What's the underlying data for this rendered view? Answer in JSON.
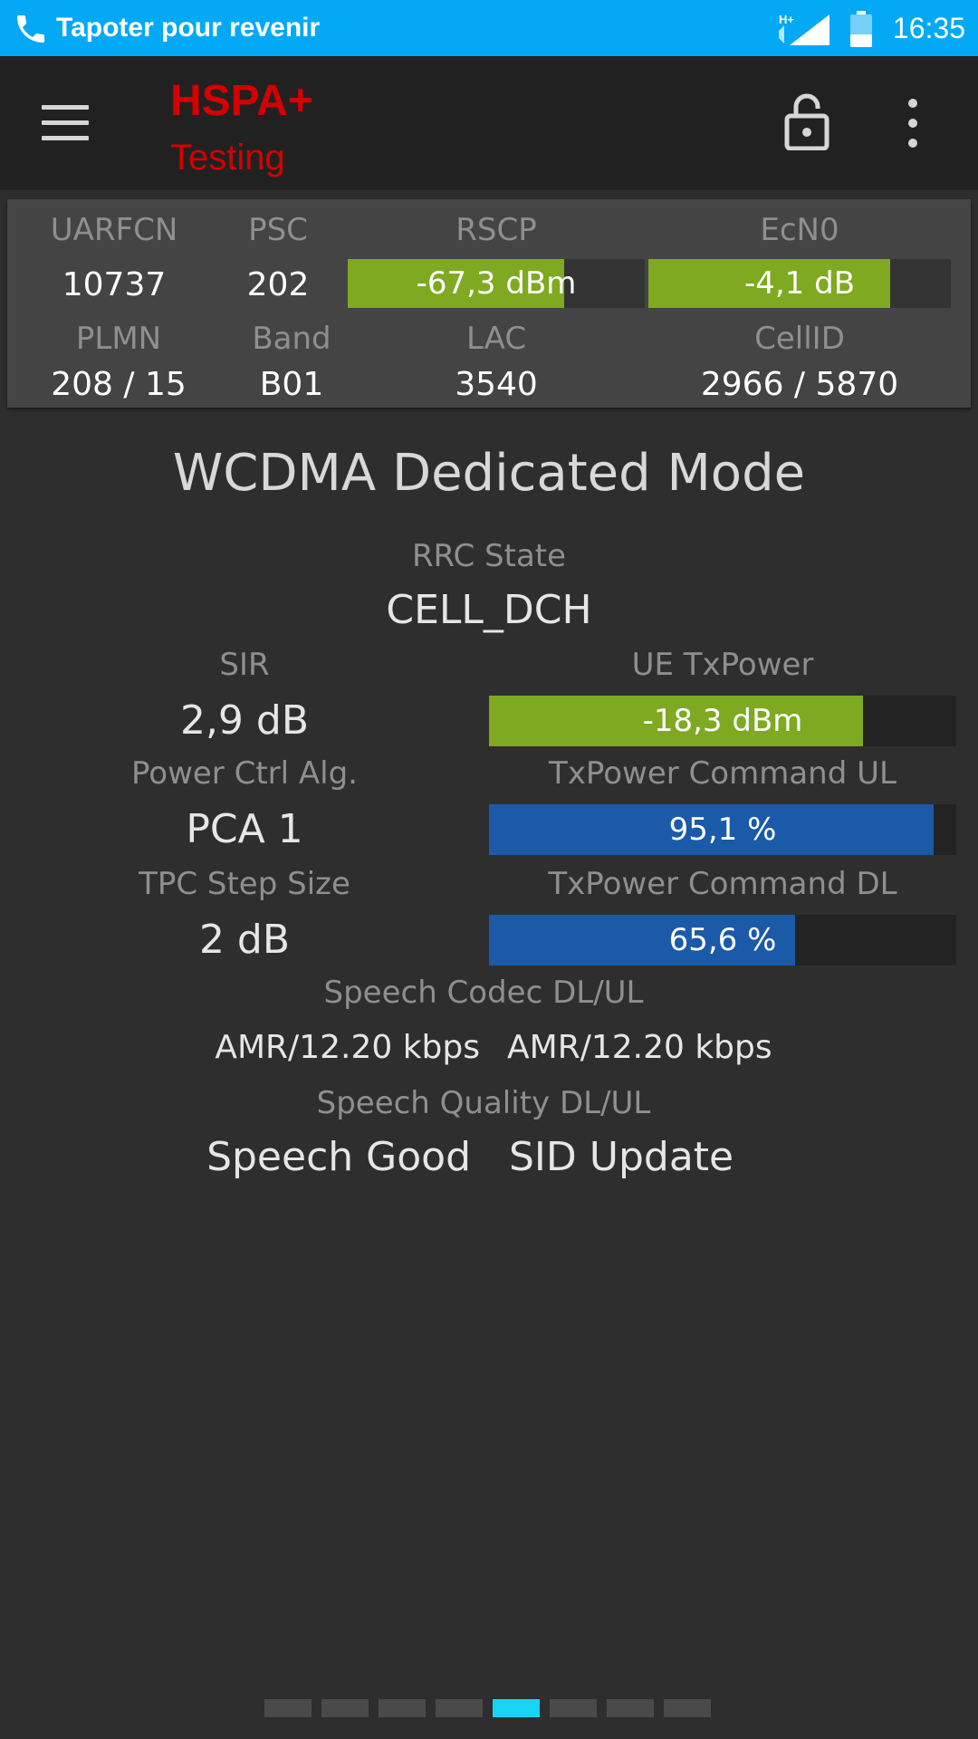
{
  "status_bar": {
    "text": "Tapoter pour revenir",
    "network": "H+",
    "time": "16:35",
    "bg_color": "#03a9f4"
  },
  "app_bar": {
    "title": "HSPA+",
    "subtitle": "Testing",
    "title_color": "#d50000",
    "icons": [
      "menu-icon",
      "lock-open-icon",
      "more-vert-icon"
    ]
  },
  "cell_info": {
    "uarfcn": {
      "label": "UARFCN",
      "value": "10737"
    },
    "psc": {
      "label": "PSC",
      "value": "202"
    },
    "rscp": {
      "label": "RSCP",
      "value": "-67,3 dBm",
      "level": 0.73
    },
    "ecn0": {
      "label": "EcN0",
      "value": "-4,1 dB",
      "level": 0.8
    },
    "plmn": {
      "label": "PLMN",
      "value": "208 / 15"
    },
    "band": {
      "label": "Band",
      "value": "B01"
    },
    "lac": {
      "label": "LAC",
      "value": "3540"
    },
    "cellid": {
      "label": "CellID",
      "value": "2966 / 5870"
    },
    "bar_color": "#7fa921"
  },
  "main": {
    "title": "WCDMA Dedicated Mode",
    "rrc_state": {
      "label": "RRC State",
      "value": "CELL_DCH"
    },
    "sir": {
      "label": "SIR",
      "value": "2,9 dB"
    },
    "ue_txpower": {
      "label": "UE TxPower",
      "value": "-18,3 dBm",
      "level": 0.8,
      "color": "#7fa921"
    },
    "power_ctrl_alg": {
      "label": "Power Ctrl Alg.",
      "value": "PCA 1"
    },
    "txpower_cmd_ul": {
      "label": "TxPower Command UL",
      "value": "95,1 %",
      "level": 0.951,
      "color": "#1a5aa8"
    },
    "tpc_step_size": {
      "label": "TPC Step Size",
      "value": "2 dB"
    },
    "txpower_cmd_dl": {
      "label": "TxPower Command DL",
      "value": "65,6 %",
      "level": 0.656,
      "color": "#1a5aa8"
    },
    "speech_codec": {
      "label": "Speech Codec DL/UL",
      "dl": "AMR/12.20 kbps",
      "ul": "AMR/12.20 kbps"
    },
    "speech_quality": {
      "label": "Speech Quality DL/UL",
      "dl": "Speech Good",
      "ul": "SID Update"
    }
  },
  "pager": {
    "count": 8,
    "active_index": 4,
    "active_color": "#18d4f3"
  }
}
